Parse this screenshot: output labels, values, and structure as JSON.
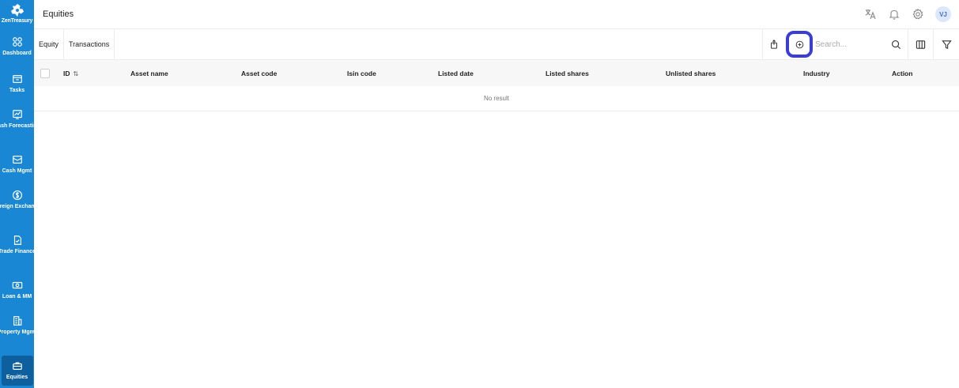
{
  "brand": {
    "name": "ZenTreasury"
  },
  "sidebar": {
    "items": [
      {
        "label": "Dashboard",
        "icon": "dashboard-icon"
      },
      {
        "label": "Tasks",
        "icon": "tasks-icon"
      },
      {
        "label": "Cash Forecasting",
        "icon": "forecast-icon"
      },
      {
        "label": "Cash Mgmt",
        "icon": "cash-icon"
      },
      {
        "label": "Foreign Exchange",
        "icon": "dollar-icon"
      },
      {
        "label": "Trade Finance",
        "icon": "document-icon"
      },
      {
        "label": "Loan & MM",
        "icon": "banknote-icon"
      },
      {
        "label": "Property Mgmt",
        "icon": "building-icon"
      },
      {
        "label": "Equities",
        "icon": "briefcase-icon",
        "active": true
      }
    ]
  },
  "header": {
    "title": "Equities",
    "avatar_initials": "VJ"
  },
  "toolbar": {
    "tabs": [
      {
        "label": "Equity"
      },
      {
        "label": "Transactions"
      }
    ],
    "search_placeholder": "Search..."
  },
  "table": {
    "columns": [
      "ID",
      "Asset name",
      "Asset code",
      "Isin code",
      "Listed date",
      "Listed shares",
      "Unlisted shares",
      "Industry",
      "Action"
    ],
    "empty_text": "No result"
  },
  "colors": {
    "sidebar_bg": "#1a87d4",
    "sidebar_active": "#0e5f9e",
    "highlight_ring": "#3a3ed4"
  }
}
